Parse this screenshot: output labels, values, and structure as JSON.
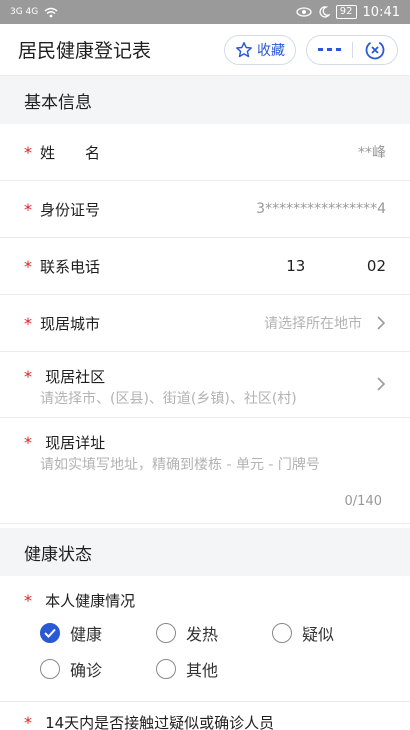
{
  "status_bar": {
    "signal_left": "3G 4G",
    "battery": "92",
    "time": "10:41",
    "icons": [
      "eye-icon",
      "moon-icon",
      "battery-icon"
    ]
  },
  "header": {
    "title": "居民健康登记表",
    "favorite_label": "收藏",
    "more_icon": "more-dots-icon",
    "close_icon": "close-target-icon",
    "accent": "#2a59d6"
  },
  "section_basic": {
    "title": "基本信息"
  },
  "form": {
    "name": {
      "label": "姓　　名",
      "value": "**峰"
    },
    "id": {
      "label": "身份证号",
      "value": "3****************4"
    },
    "phone": {
      "label": "联系电话",
      "value_prefix": "13",
      "value_suffix": "02"
    },
    "city": {
      "label": "现居城市",
      "placeholder": "请选择所在地市"
    },
    "community": {
      "label": "现居社区",
      "placeholder": "请选择市、(区县)、街道(乡镇)、社区(村)"
    },
    "address": {
      "label": "现居详址",
      "placeholder": "请如实填写地址，精确到楼栋 - 单元 - 门牌号",
      "counter": "0/140"
    }
  },
  "section_health": {
    "title": "健康状态"
  },
  "health": {
    "label": "本人健康情况",
    "options": [
      "健康",
      "发热",
      "疑似",
      "确诊",
      "其他"
    ],
    "selected": "健康"
  },
  "contact_question": {
    "label": "14天内是否接触过疑似或确诊人员"
  },
  "required_color": "#e02020"
}
